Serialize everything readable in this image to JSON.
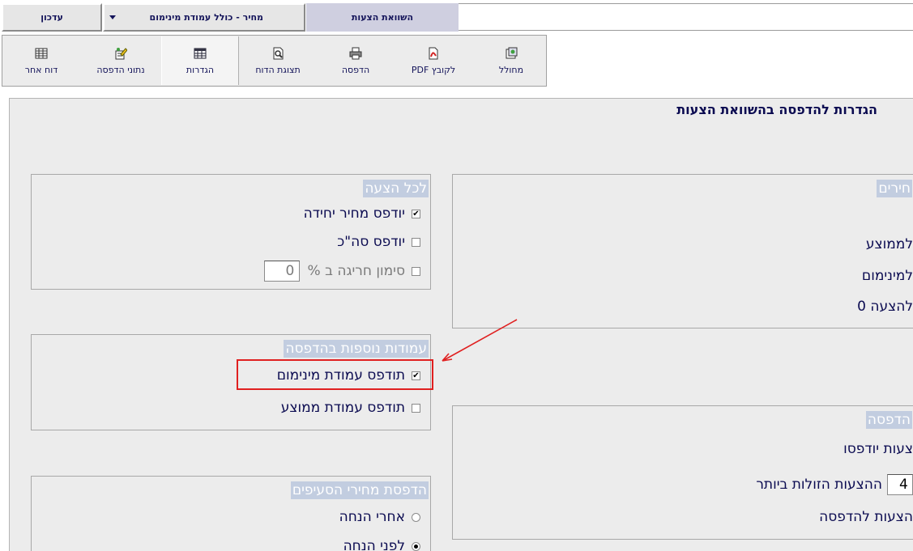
{
  "topbar": {
    "update_label": "עדכון",
    "price_label": "מחיר - כולל עמודת מינימום",
    "compare_label": "השוואת הצעות"
  },
  "toolbar": {
    "items": [
      {
        "label": "דוח אחר",
        "icon": "table-icon"
      },
      {
        "label": "נתוני הדפסה",
        "icon": "edit-data-icon"
      },
      {
        "label": "הגדרות",
        "icon": "grid-settings-icon"
      },
      {
        "label": "תצוגת הדוח",
        "icon": "print-preview-icon"
      },
      {
        "label": "הדפסה",
        "icon": "printer-icon"
      },
      {
        "label": "לקובץ PDF",
        "icon": "pdf-icon"
      },
      {
        "label": "מחולל",
        "icon": "generator-icon"
      }
    ]
  },
  "page": {
    "title": "הגדרות להדפסה בהשוואת הצעות"
  },
  "per_offer": {
    "legend": "לכל הצעה",
    "unit_price": {
      "label": "יודפס מחיר יחידה",
      "checked": true
    },
    "total": {
      "label": "יודפס סה\"כ",
      "checked": false
    },
    "deviation": {
      "label": "סימון חריגה ב %",
      "checked": false,
      "value": "0"
    }
  },
  "extra_columns": {
    "legend": "עמודות נוספות בהדפסה",
    "min_column": {
      "label": "תודפס עמודת מינימום",
      "checked": true
    },
    "avg_column": {
      "label": "תודפס עמודת ממוצע",
      "checked": false
    }
  },
  "item_prices": {
    "legend": "הדפסת מחירי הסעיפים",
    "after_discount": {
      "label": "אחרי הנחה",
      "selected": false
    },
    "before_discount": {
      "label": "לפני הנחה",
      "selected": true
    }
  },
  "prices_group": {
    "legend": "חירים",
    "to_average": "לממוצע",
    "to_minimum": "למינימום",
    "to_offer": "להצעה 0"
  },
  "print_group": {
    "legend": "הדפסה",
    "offers_printed": "צעות יודפסו",
    "cheapest_value": "4",
    "cheapest_label": "ההצעות הזולות ביותר",
    "offers_to_print": "הצעות להדפסה"
  },
  "colors": {
    "accent_legend": "#c2cde0",
    "highlight": "#e02020",
    "text": "#0a0a50"
  }
}
